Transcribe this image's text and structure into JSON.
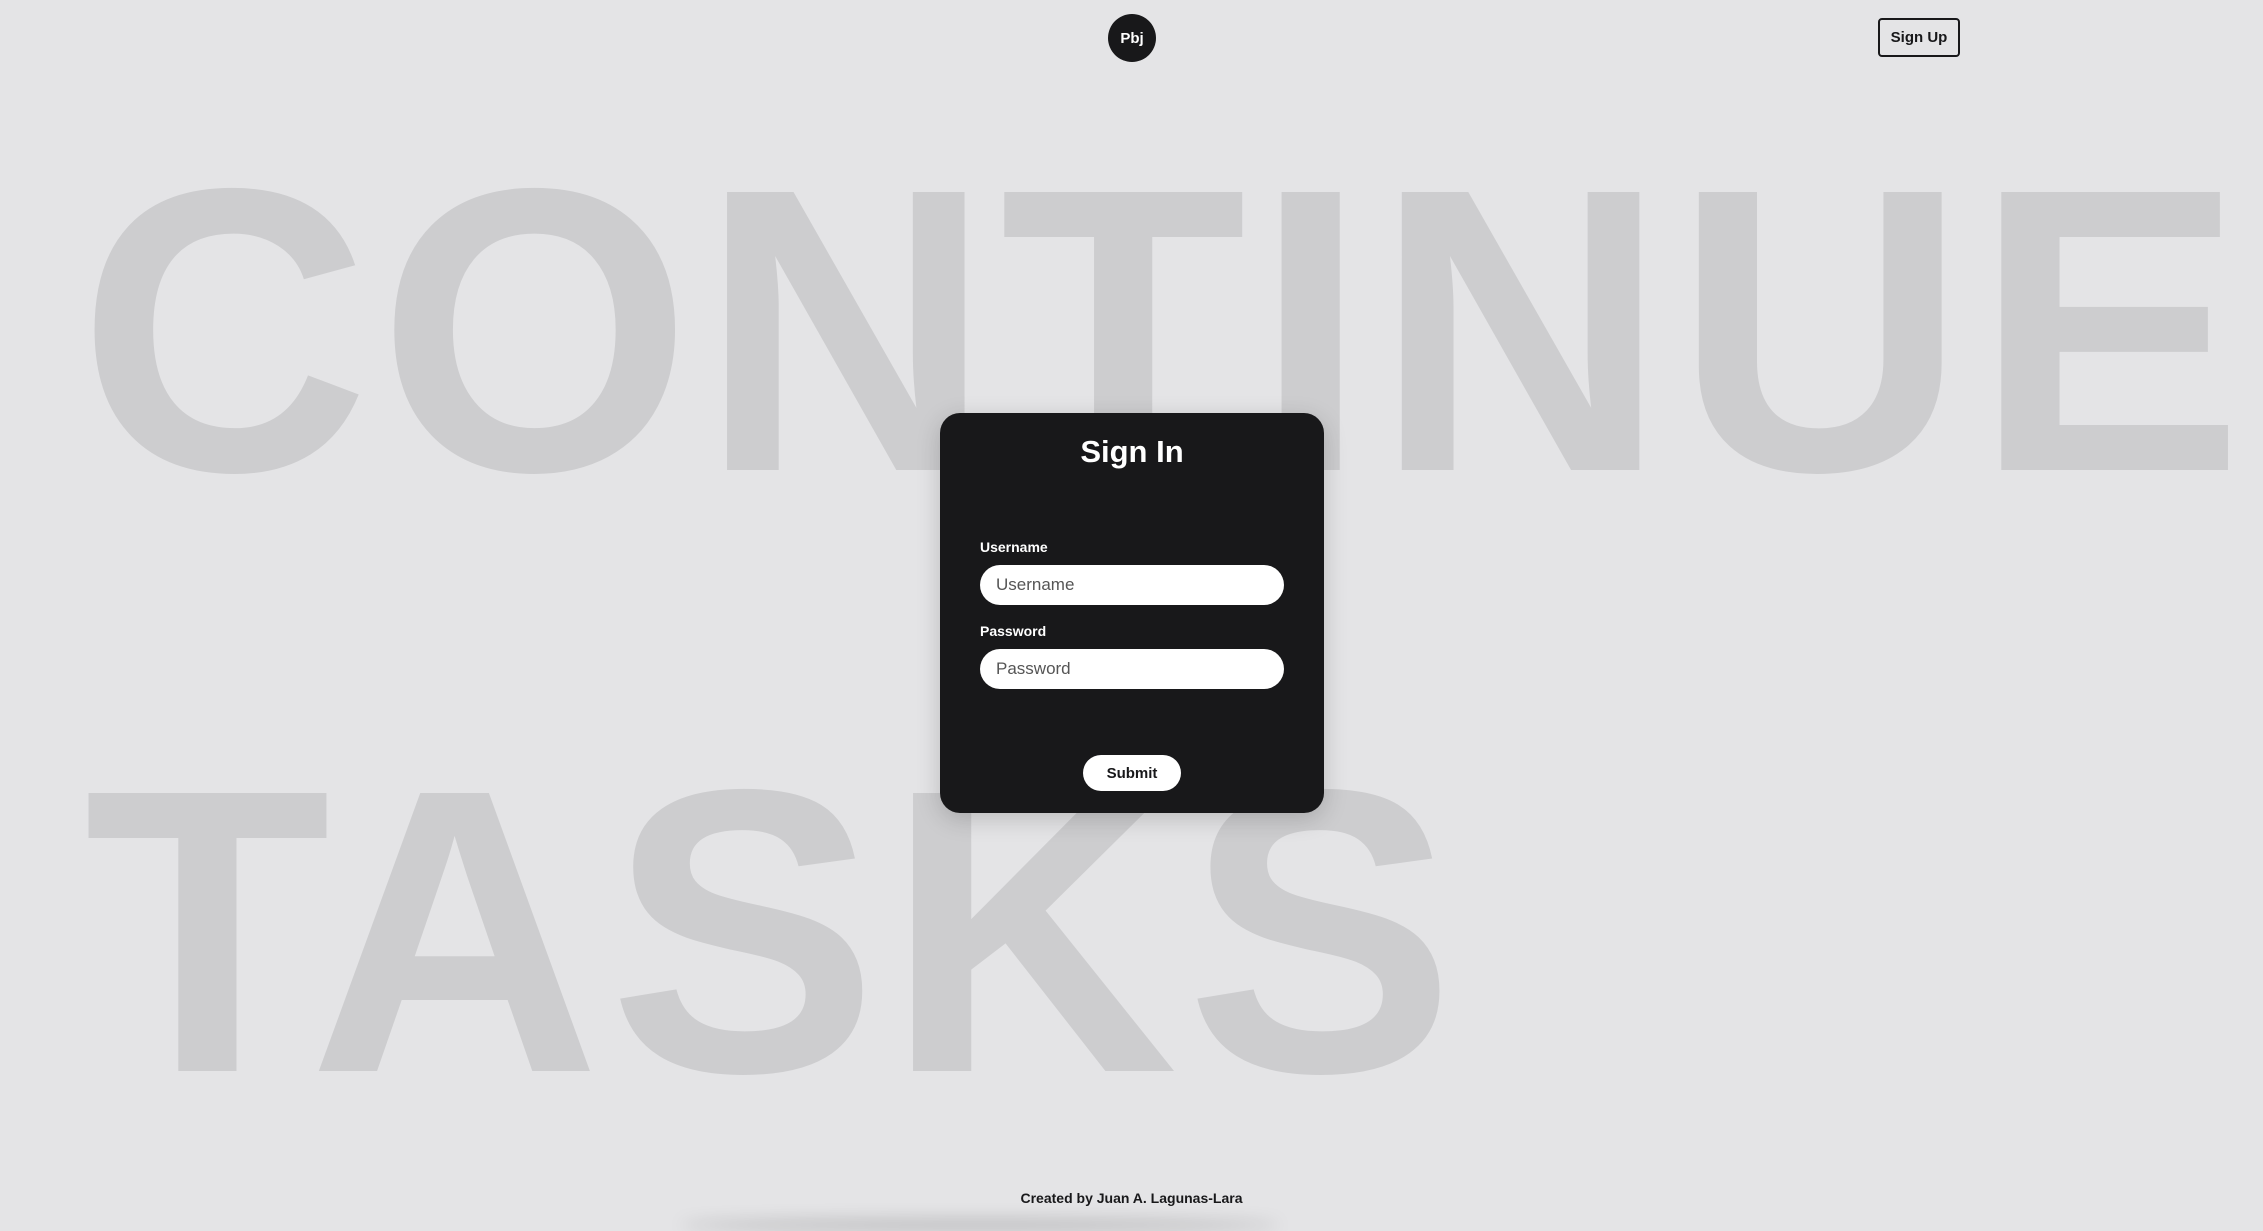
{
  "header": {
    "logo_text": "Pbj",
    "signup_label": "Sign Up"
  },
  "background": {
    "line1": "CONTINUE",
    "line2": "TASKS"
  },
  "signin_form": {
    "title": "Sign In",
    "username_label": "Username",
    "username_placeholder": "Username",
    "username_value": "",
    "password_label": "Password",
    "password_placeholder": "Password",
    "password_value": "",
    "submit_label": "Submit"
  },
  "footer": {
    "credit": "Created by Juan A. Lagunas-Lara"
  },
  "colors": {
    "page_background": "#e4e4e6",
    "background_text": "#cdcdcf",
    "card": "#18181a",
    "text_on_card": "#ffffff"
  }
}
